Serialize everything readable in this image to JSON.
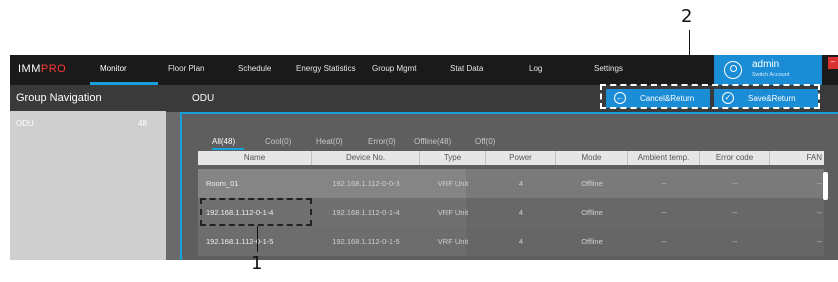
{
  "callouts": {
    "one": "1",
    "two": "2"
  },
  "nav": {
    "logo_main": "IMM",
    "logo_accent": "PRO",
    "items": [
      "Monitor",
      "Floor Plan",
      "Schedule",
      "Energy Statistics",
      "Group Mgmt",
      "Stat Data",
      "Log",
      "Settings"
    ],
    "active_item": "Monitor"
  },
  "user": {
    "name": "admin",
    "switch_label": "Switch Account",
    "icon": "user-circle-icon"
  },
  "sidebar": {
    "title": "Group Navigation",
    "groups": [
      {
        "label": "ODU",
        "count": "48"
      }
    ]
  },
  "main": {
    "title": "ODU",
    "cancel_label": "Cancel&Return",
    "save_label": "Save&Return",
    "cancel_icon": "back-arrow-icon",
    "save_icon": "check-icon"
  },
  "tabs": [
    "All(48)",
    "Cool(0)",
    "Heat(0)",
    "Error(0)",
    "Offline(48)",
    "Off(0)"
  ],
  "table": {
    "columns": [
      "Name",
      "Device No.",
      "Type",
      "Power",
      "Mode",
      "Ambient temp.",
      "Error code",
      "FAN"
    ],
    "rows": [
      [
        "Room_01",
        "192.168.1.112-0-0-3",
        "VRF Unit",
        "4",
        "Offline",
        "--",
        "--",
        "--"
      ],
      [
        "192.168.1.112-0-1-4",
        "192.168.1.112-0-1-4",
        "VRF Unit",
        "4",
        "Offline",
        "--",
        "--",
        "--"
      ],
      [
        "192.168.1.112-0-1-5",
        "192.168.1.112-0-1-5",
        "VRF Unit",
        "4",
        "Offline",
        "--",
        "--",
        "--"
      ]
    ]
  },
  "colors": {
    "accent": "#1a8dd6",
    "logo_accent": "#ff3a3a",
    "nav_bg": "#1a1a1a"
  }
}
